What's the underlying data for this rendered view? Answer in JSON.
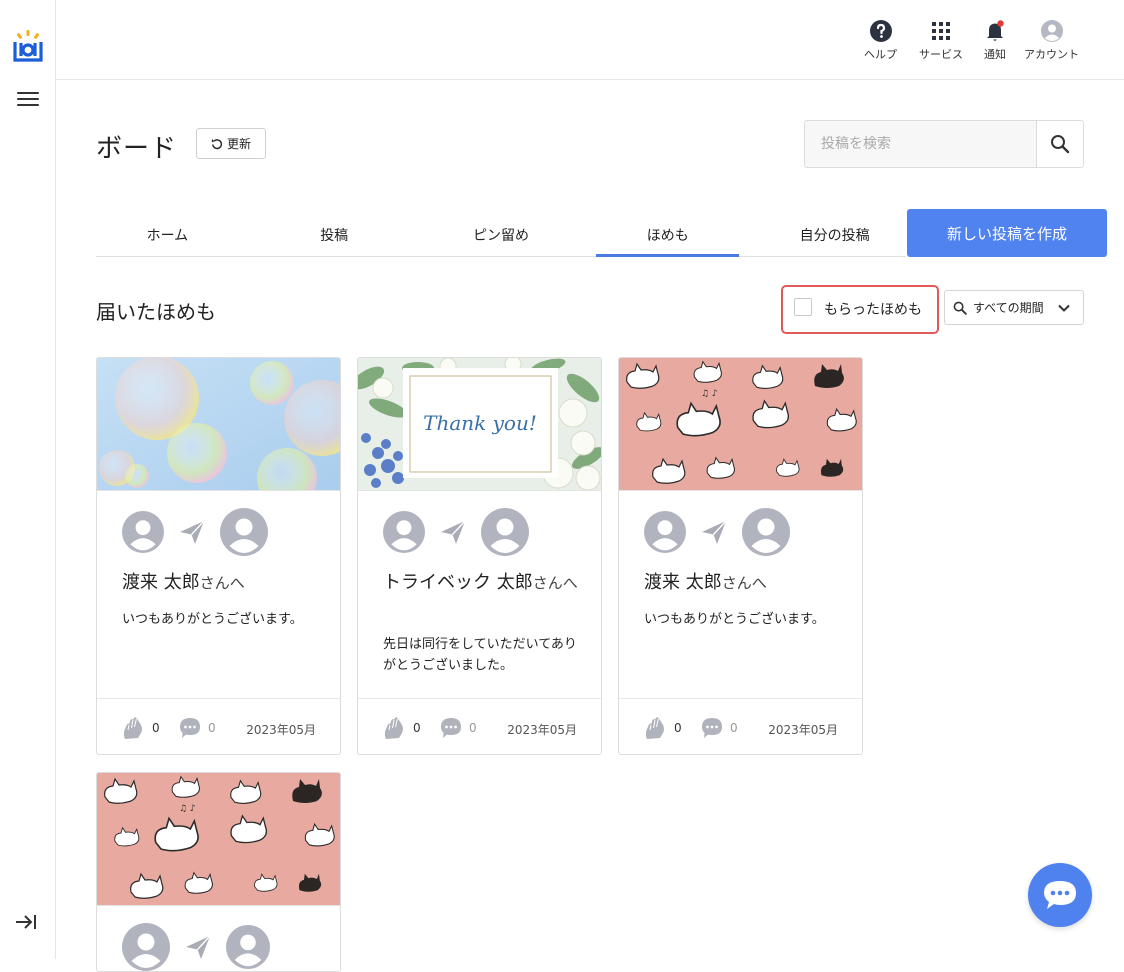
{
  "header": {
    "help_label": "ヘルプ",
    "services_label": "サービス",
    "notifications_label": "通知",
    "account_label": "アカウント"
  },
  "page": {
    "title": "ボード",
    "refresh_label": "更新",
    "search_placeholder": "投稿を検索"
  },
  "tabs": [
    {
      "label": "ホーム"
    },
    {
      "label": "投稿"
    },
    {
      "label": "ピン留め"
    },
    {
      "label": "ほめも",
      "active": true
    },
    {
      "label": "自分の投稿"
    }
  ],
  "new_post_label": "新しい投稿を作成",
  "section": {
    "title": "届いたほめも",
    "filter_label": "もらったほめも",
    "filter_checked": false,
    "period_label": "すべての期間"
  },
  "cards": [
    {
      "image": "bubbles",
      "recipient": "渡来 太郎",
      "suffix": "さんへ",
      "message": "いつもありがとうございます。",
      "claps": "0",
      "comments": "0",
      "date": "2023年05月"
    },
    {
      "image": "thank-you-flowers",
      "image_text": "Thank you!",
      "recipient": "トライベック 太郎",
      "suffix": "さんへ",
      "message": "先日は同行をしていただいてありがとうございました。",
      "claps": "0",
      "comments": "0",
      "date": "2023年05月"
    },
    {
      "image": "cats",
      "recipient": "渡来 太郎",
      "suffix": "さんへ",
      "message": "いつもありがとうございます。",
      "claps": "0",
      "comments": "0",
      "date": "2023年05月"
    },
    {
      "image": "cats"
    }
  ],
  "colors": {
    "accent": "#5083f0",
    "highlight_border": "#e05a5a",
    "cat_background": "#e8aaa0",
    "notification_dot": "#e53935"
  }
}
